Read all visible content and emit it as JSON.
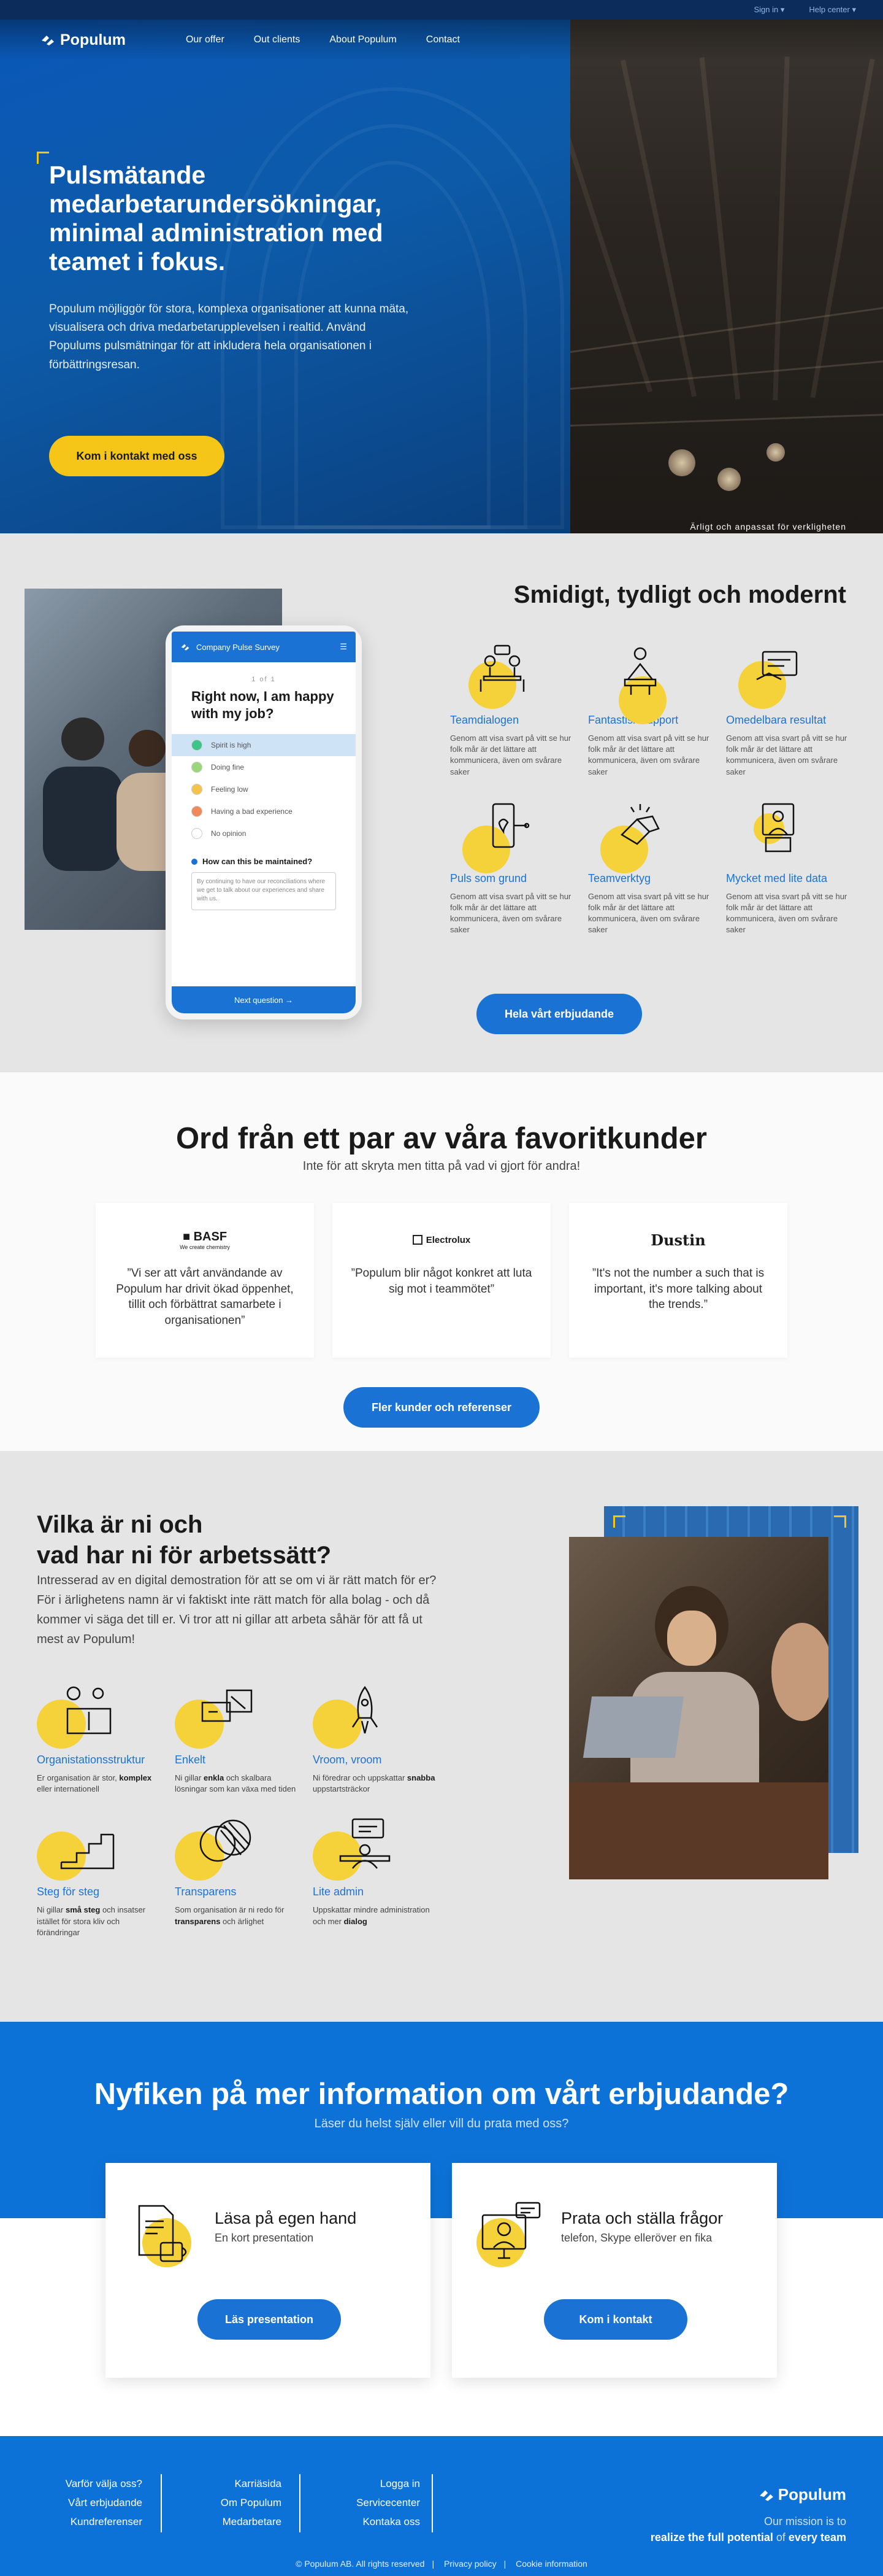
{
  "topbar": {
    "signin": "Sign in ▾",
    "help": "Help center ▾"
  },
  "nav": {
    "logo": "Populum",
    "links": [
      "Our offer",
      "Out clients",
      "About Populum",
      "Contact"
    ]
  },
  "hero": {
    "title": "Pulsmätande medarbetarundersökningar, minimal administration med teamet i fokus.",
    "text": "Populum möjliggör för stora, komplexa organisationer att kunna mäta, visualisera och driva medarbetarupplevelsen i realtid. Använd Populums pulsmätningar för att inkludera hela organisationen i förbättringsresan.",
    "cta": "Kom i kontakt med oss",
    "caption": "Ärligt och anpassat för verkligheten"
  },
  "phone": {
    "header": "Company Pulse Survey",
    "step": "1 of 1",
    "question": "Right now, I am happy with my job?",
    "options": [
      {
        "label": "Spirit is high",
        "color": "#3ec38a",
        "selected": true
      },
      {
        "label": "Doing fine",
        "color": "#9ad77a",
        "selected": false
      },
      {
        "label": "Feeling low",
        "color": "#f5c34a",
        "selected": false
      },
      {
        "label": "Having a bad experience",
        "color": "#f08a5d",
        "selected": false
      },
      {
        "label": "No opinion",
        "color": "#ffffff",
        "selected": false
      }
    ],
    "sub_question": "How can this be maintained?",
    "answer": "By continuing to have our reconciliations where we get to talk about our experiences and share with us.",
    "next": "Next question →"
  },
  "features": {
    "title": "Smidigt, tydligt och modernt",
    "items": [
      {
        "name": "Teamdialogen",
        "desc": "Genom att visa svart på vitt se hur folk mår är det lättare att kommunicera, även om svårare saker"
      },
      {
        "name": "Fantastisk support",
        "desc": "Genom att visa svart på vitt se hur folk mår är det lättare att kommunicera, även om svårare saker"
      },
      {
        "name": "Omedelbara resultat",
        "desc": "Genom att visa svart på vitt se hur folk mår är det lättare att kommunicera, även om svårare saker"
      },
      {
        "name": "Puls som grund",
        "desc": "Genom att visa svart på vitt se hur folk mår är det lättare att kommunicera, även om svårare saker"
      },
      {
        "name": "Teamverktyg",
        "desc": "Genom att visa svart på vitt se hur folk mår är det lättare att kommunicera, även om svårare saker"
      },
      {
        "name": "Mycket med lite data",
        "desc": "Genom att visa svart på vitt se hur folk mår är det lättare att kommunicera, även om svårare saker"
      }
    ],
    "cta": "Hela vårt erbjudande"
  },
  "testimonials": {
    "title": "Ord från ett par av våra favoritkunder",
    "subtitle": "Inte för att skryta men titta på vad vi gjort för andra!",
    "cards": [
      {
        "logo": "■ BASF",
        "logo_sub": "We create chemistry",
        "quote": "”Vi ser att vårt användande av Populum har drivit ökad öppenhet, tillit och förbättrat samarbete i organisationen”"
      },
      {
        "logo": "Electrolux",
        "logo_sub": "",
        "quote": "”Populum blir något konkret att luta sig mot i teammötet”"
      },
      {
        "logo": "Dustin",
        "logo_sub": "",
        "quote": "”It's not the number a such that is important, it's more talking about the trends.”"
      }
    ],
    "cta": "Fler kunder och referenser"
  },
  "ways": {
    "title_1": "Vilka är ni och",
    "title_2": "vad har ni för arbetssätt?",
    "text": "Intresserad av en digital demostration för att se om vi är rätt match för er? För i ärlighetens namn är vi faktiskt inte rätt match för alla bolag - och då kommer vi säga det till er. Vi tror att ni gillar att arbeta såhär för att få ut mest av Populum!",
    "items": [
      {
        "name": "Organistationsstruktur",
        "desc_1": "Er organisation är stor, ",
        "desc_b": "komplex",
        "desc_2": " eller internationell"
      },
      {
        "name": "Enkelt",
        "desc_1": "Ni gillar ",
        "desc_b": "enkla",
        "desc_2": " och skalbara lösningar som kan växa med tiden"
      },
      {
        "name": "Vroom, vroom",
        "desc_1": "Ni föredrar och uppskattar ",
        "desc_b": "snabba",
        "desc_2": " uppstartsträckor"
      },
      {
        "name": "Steg för steg",
        "desc_1": "Ni gillar ",
        "desc_b": "små steg",
        "desc_2": " och insatser istället för stora kliv och förändringar"
      },
      {
        "name": "Transparens",
        "desc_1": "Som organisation är ni redo för ",
        "desc_b": "transparens",
        "desc_2": " och ärlighet"
      },
      {
        "name": "Lite admin",
        "desc_1": "Uppskattar mindre administration och mer ",
        "desc_b": "dialog",
        "desc_2": ""
      }
    ]
  },
  "more": {
    "title": "Nyfiken på mer information om vårt erbjudande?",
    "subtitle": "Läser du helst själv eller vill du prata med oss?",
    "cards": [
      {
        "title": "Läsa på egen hand",
        "sub": "En kort presentation",
        "btn": "Läs presentation"
      },
      {
        "title": "Prata och ställa frågor",
        "sub": "telefon, Skype elleröver en fika",
        "btn": "Kom i kontakt"
      }
    ]
  },
  "footer": {
    "col1": [
      "Varför välja oss?",
      "Vårt erbjudande",
      "Kundreferenser"
    ],
    "col2": [
      "Karriäsida",
      "Om Populum",
      "Medarbetare"
    ],
    "col3": [
      "Logga in",
      "Servicecenter",
      "Kontaka oss"
    ],
    "logo": "Populum",
    "mission_1": "Our mission is to",
    "mission_2a": "realize the full potential",
    "mission_2b": " of ",
    "mission_2c": "every team",
    "copyright": "© Populum AB. All rights reserved",
    "privacy": "Privacy policy",
    "cookie": "Cookie information"
  }
}
